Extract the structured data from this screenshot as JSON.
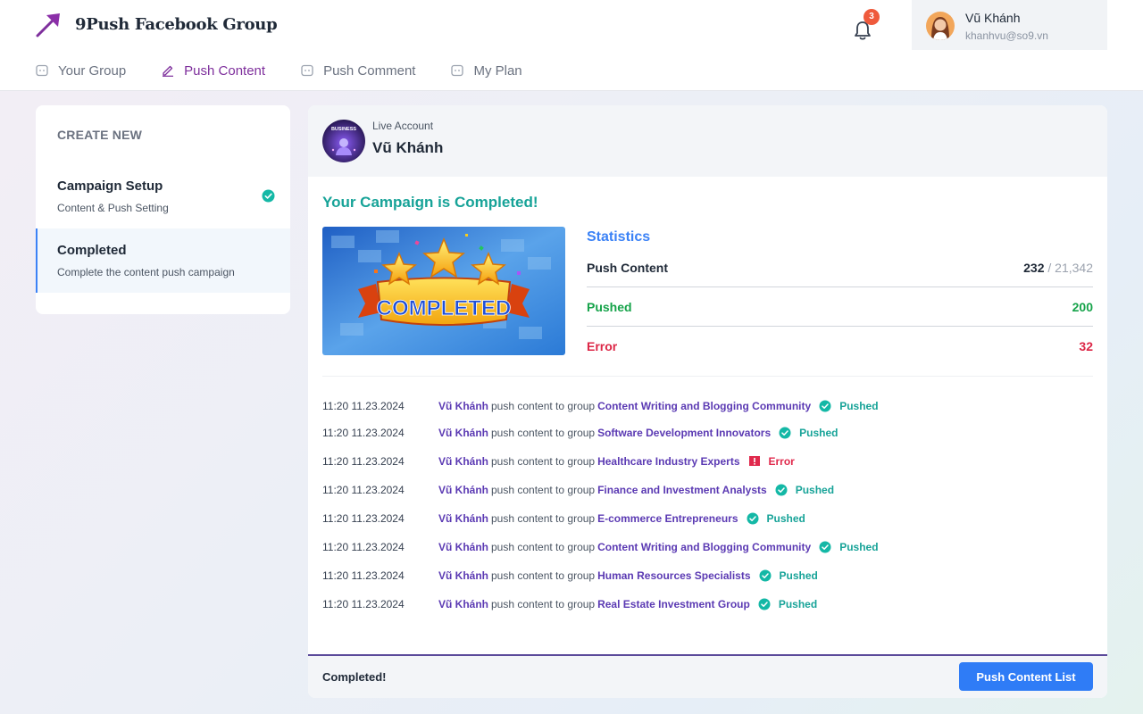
{
  "app": {
    "title": "9Push Facebook Group"
  },
  "header": {
    "notifications_count": "3",
    "user": {
      "name": "Vũ Khánh",
      "email": "khanhvu@so9.vn"
    }
  },
  "nav": {
    "items": [
      {
        "label": "Your Group",
        "icon": "group-icon",
        "active": false
      },
      {
        "label": "Push Content",
        "icon": "edit-icon",
        "active": true
      },
      {
        "label": "Push Comment",
        "icon": "comment-icon",
        "active": false
      },
      {
        "label": "My Plan",
        "icon": "plan-icon",
        "active": false
      }
    ]
  },
  "sidebar": {
    "heading": "CREATE NEW",
    "steps": [
      {
        "title": "Campaign Setup",
        "subtitle": "Content & Push Setting",
        "done": true
      },
      {
        "title": "Completed",
        "subtitle": "Complete the content push campaign",
        "active": true
      }
    ]
  },
  "account": {
    "label": "Live Account",
    "name": "Vũ Khánh",
    "avatar_text": "BUSINESS"
  },
  "campaign": {
    "title": "Your Campaign is Completed!",
    "banner_text": "COMPLETED"
  },
  "stats": {
    "title": "Statistics",
    "push_content": {
      "label": "Push Content",
      "value": "232",
      "total": "/ 21,342"
    },
    "pushed": {
      "label": "Pushed",
      "value": "200"
    },
    "error": {
      "label": "Error",
      "value": "32"
    }
  },
  "log": {
    "connector": "push content to group",
    "rows": [
      {
        "time": "11:20 11.23.2024",
        "user": "Vũ Khánh",
        "group": "Content Writing and Blogging Community",
        "status": "Pushed",
        "type": "pushed"
      },
      {
        "time": "11:20 11.23.2024",
        "user": "Vũ Khánh",
        "group": "Software Development Innovators",
        "status": "Pushed",
        "type": "pushed"
      },
      {
        "time": "11:20 11.23.2024",
        "user": "Vũ Khánh",
        "group": "Healthcare Industry Experts",
        "status": "Error",
        "type": "error"
      },
      {
        "time": "11:20 11.23.2024",
        "user": "Vũ Khánh",
        "group": "Finance and Investment Analysts",
        "status": "Pushed",
        "type": "pushed"
      },
      {
        "time": "11:20 11.23.2024",
        "user": "Vũ Khánh",
        "group": "E-commerce Entrepreneurs",
        "status": "Pushed",
        "type": "pushed"
      },
      {
        "time": "11:20 11.23.2024",
        "user": "Vũ Khánh",
        "group": "Content Writing and Blogging Community",
        "status": "Pushed",
        "type": "pushed"
      },
      {
        "time": "11:20 11.23.2024",
        "user": "Vũ Khánh",
        "group": "Human Resources Specialists",
        "status": "Pushed",
        "type": "pushed"
      },
      {
        "time": "11:20 11.23.2024",
        "user": "Vũ Khánh",
        "group": "Real Estate Investment Group",
        "status": "Pushed",
        "type": "pushed"
      }
    ]
  },
  "footer": {
    "status": "Completed!",
    "button_label": "Push Content List"
  },
  "colors": {
    "brand": "#7e2f9c",
    "accent_blue": "#2f7cf6",
    "success": "#17a398",
    "error": "#e0294c",
    "link": "#5b3ab3"
  }
}
